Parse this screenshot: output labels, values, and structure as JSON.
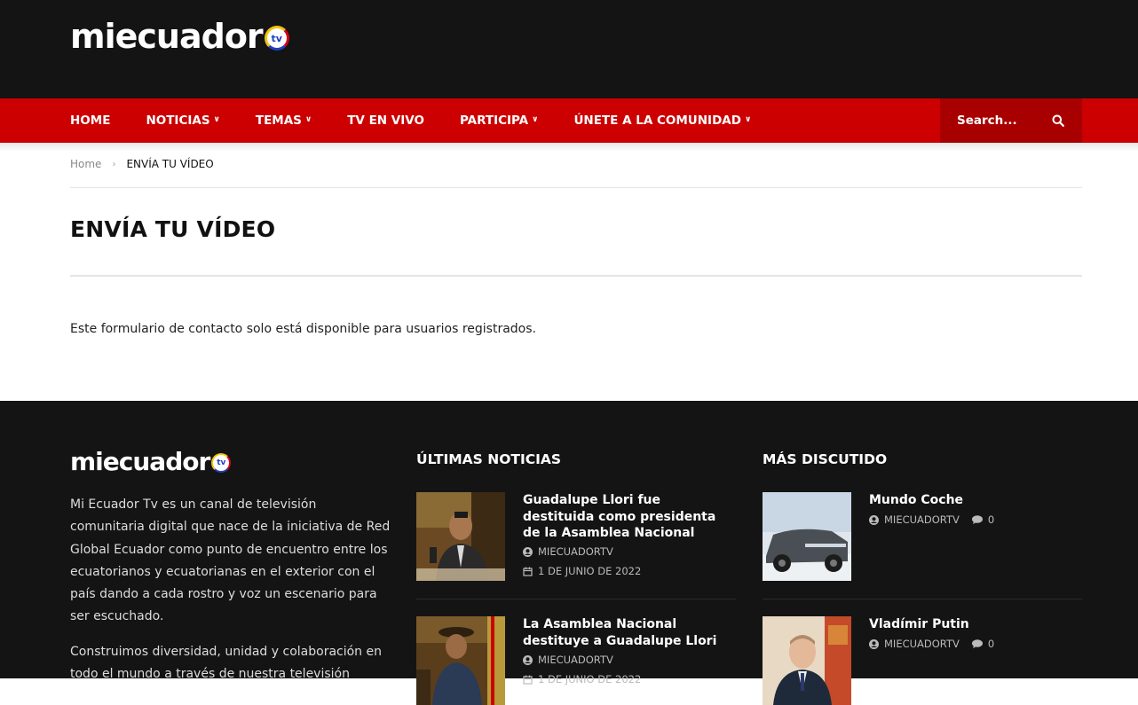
{
  "brand": {
    "logo_text": "miecuador",
    "logo_badge": "tv"
  },
  "nav": {
    "items": [
      {
        "label": "HOME",
        "has_dropdown": false
      },
      {
        "label": "NOTICIAS",
        "has_dropdown": true
      },
      {
        "label": "TEMAS",
        "has_dropdown": true
      },
      {
        "label": "TV EN VIVO",
        "has_dropdown": false
      },
      {
        "label": "PARTICIPA",
        "has_dropdown": true
      },
      {
        "label": "ÚNETE A LA COMUNIDAD",
        "has_dropdown": true
      }
    ],
    "search_placeholder": "Search..."
  },
  "breadcrumb": {
    "home": "Home",
    "separator": "›",
    "current": "ENVÍA TU VÍDEO"
  },
  "page": {
    "title": "ENVÍA TU VÍDEO",
    "notice": "Este formulario de contacto solo está disponible para usuarios registrados."
  },
  "footer": {
    "about": [
      "Mi Ecuador Tv es un canal de televisión comunitaria digital que nace de la iniciativa de Red Global Ecuador como punto de encuentro entre los ecuatorianos y ecuatorianas en el exterior con el país dando a cada rostro y voz un escenario para ser escuchado.",
      "Construimos diversidad, unidad y colaboración en todo el mundo a través de nuestra televisión"
    ],
    "latest": {
      "title": "ÚLTIMAS NOTICIAS",
      "posts": [
        {
          "title": "Guadalupe Llori fue destituida como presidenta de la Asamblea Nacional",
          "author": "MIECUADORTV",
          "date": "1 DE JUNIO DE 2022"
        },
        {
          "title": "La Asamblea Nacional destituye a Guadalupe Llori",
          "author": "MIECUADORTV",
          "date": "1 DE JUNIO DE 2022"
        }
      ]
    },
    "discussed": {
      "title": "MÁS DISCUTIDO",
      "posts": [
        {
          "title": "Mundo Coche",
          "author": "MIECUADORTV",
          "comments": "0"
        },
        {
          "title": "Vladímir Putin",
          "author": "MIECUADORTV",
          "comments": "0"
        }
      ]
    }
  },
  "colors": {
    "header_bg": "#141414",
    "nav_bg": "#cc0000",
    "search_bg": "#a80000",
    "footer_bg": "#141414"
  }
}
